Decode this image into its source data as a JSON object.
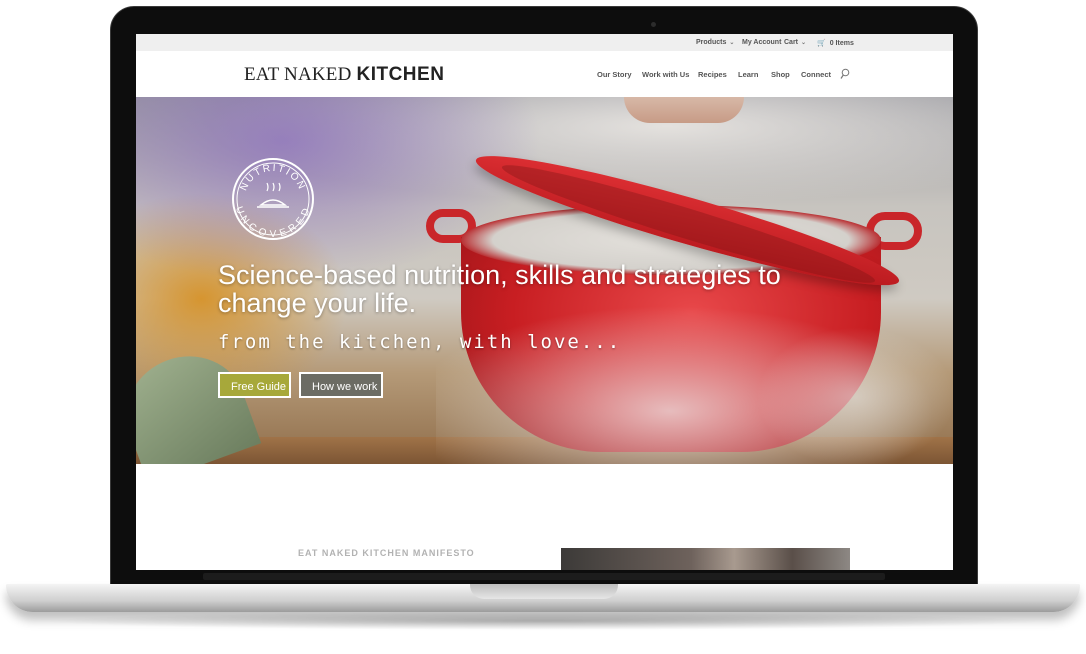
{
  "topbar": {
    "products": "Products",
    "my_account": "My Account",
    "cart": "Cart",
    "items": "0 Items"
  },
  "header": {
    "logo_light": "EAT NAKED ",
    "logo_bold": "KITCHEN",
    "nav": [
      "Our Story",
      "Work with Us",
      "Recipes",
      "Learn",
      "Shop",
      "Connect"
    ]
  },
  "hero": {
    "badge_text_top": "NUTRITION",
    "badge_text_bottom": "UNCOVERED",
    "title": "Science-based nutrition, skills and strategies to change your life.",
    "subtitle": "from the kitchen, with love...",
    "button_guide": "Free Guide",
    "button_how": "How we work"
  },
  "section": {
    "manifesto_title": "EAT NAKED KITCHEN MANIFESTO"
  },
  "colors": {
    "guide_button": "#a7a83a",
    "how_button": "#6c6c64",
    "pot_red": "#c81e22"
  }
}
